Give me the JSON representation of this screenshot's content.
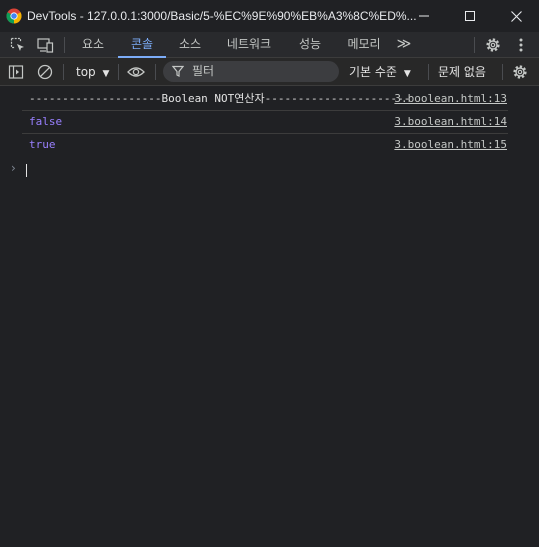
{
  "window": {
    "title": "DevTools - 127.0.0.1:3000/Basic/5-%EC%9E%90%EB%A3%8C%ED%..."
  },
  "tabs": [
    {
      "label": "요소",
      "active": false
    },
    {
      "label": "콘솔",
      "active": true
    },
    {
      "label": "소스",
      "active": false
    },
    {
      "label": "네트워크",
      "active": false
    },
    {
      "label": "성능",
      "active": false
    },
    {
      "label": "메모리",
      "active": false
    }
  ],
  "tabs_overflow_label": "≫",
  "toolbar": {
    "context": "top",
    "filter_placeholder": "필터",
    "levels": "기본 수준",
    "issues": "문제 없음"
  },
  "console": {
    "messages": [
      {
        "text": "--------------------Boolean NOT연산자----------------------",
        "source": "3.boolean.html:13",
        "type": "string"
      },
      {
        "text": "false",
        "source": "3.boolean.html:14",
        "type": "boolean"
      },
      {
        "text": "true",
        "source": "3.boolean.html:15",
        "type": "boolean"
      }
    ]
  },
  "colors": {
    "background": "#202124",
    "accent": "#7cacf8",
    "boolean": "#9980ff"
  }
}
